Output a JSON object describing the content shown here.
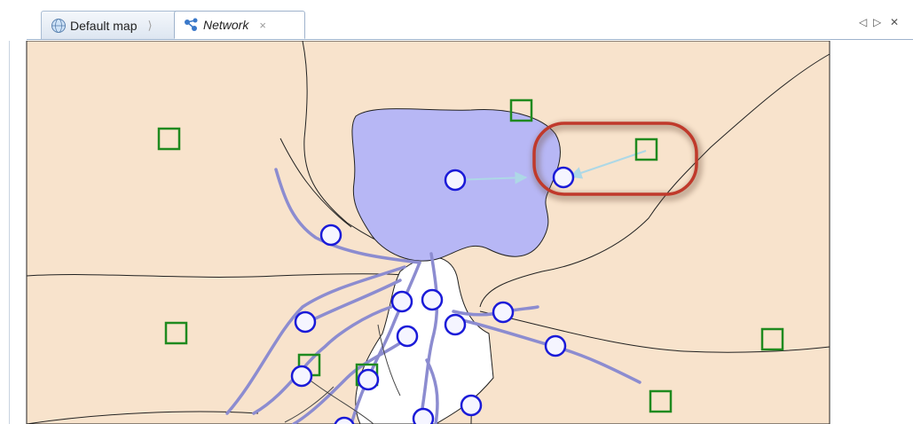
{
  "tabs": [
    {
      "label": "Default map",
      "icon": "globe-icon",
      "active": false
    },
    {
      "label": "Network",
      "icon": "network-icon",
      "active": true
    }
  ],
  "tab_controls": {
    "prev": "◁",
    "next": "▷",
    "close": "✕"
  },
  "colors": {
    "land": "#f8e3cc",
    "lake": "#b7b7f5",
    "river": "#8c8cd0",
    "node_outline": "#1a1ad8",
    "catchment_outline": "#1f8a1f",
    "highlight": "#c0392b",
    "link": "#add8e6"
  }
}
